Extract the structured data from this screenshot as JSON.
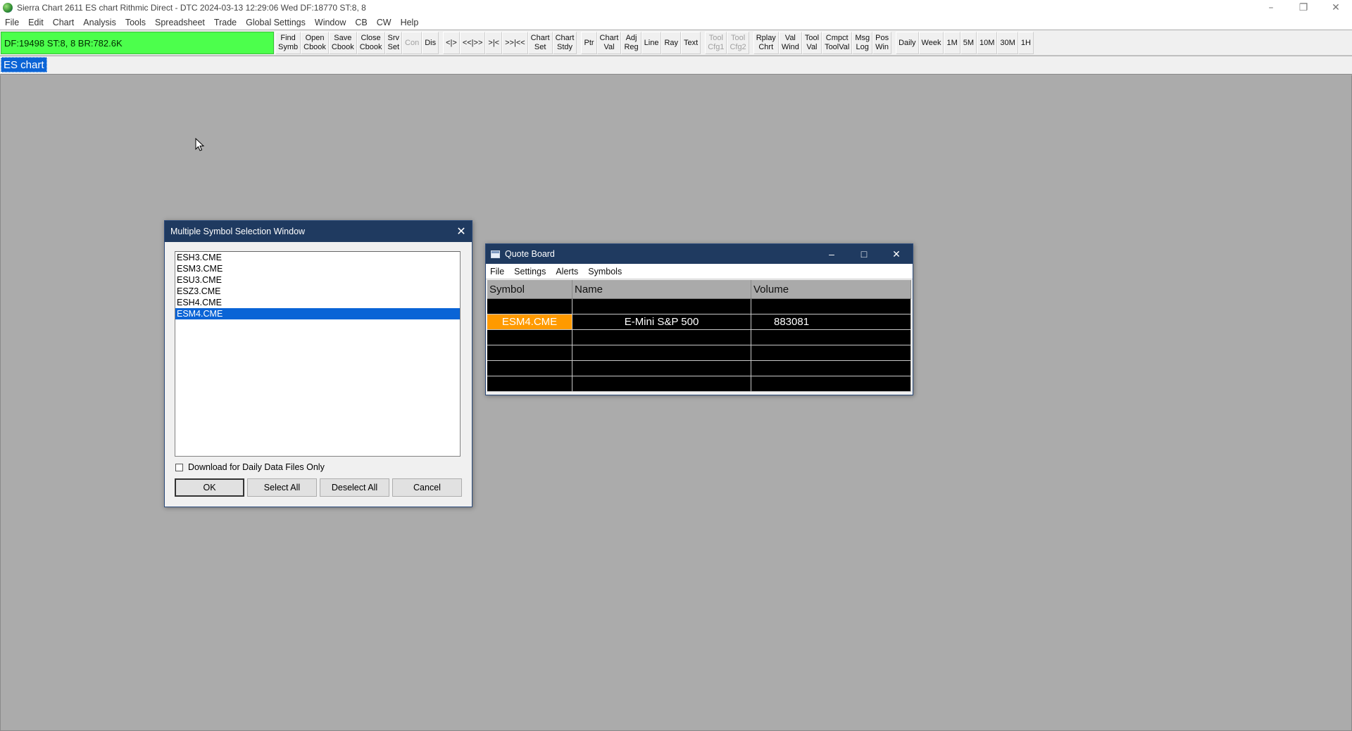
{
  "window": {
    "title": "Sierra Chart 2611 ES chart Rithmic Direct - DTC 2024-03-13  12:29:06 Wed DF:18770  ST:8, 8",
    "controls": [
      "minimize",
      "restore",
      "close"
    ]
  },
  "menu": [
    "File",
    "Edit",
    "Chart",
    "Analysis",
    "Tools",
    "Spreadsheet",
    "Trade",
    "Global Settings",
    "Window",
    "CB",
    "CW",
    "Help"
  ],
  "status": {
    "text": "DF:19498  ST:8, 8  BR:782.6K",
    "color": "#4cff4c"
  },
  "toolbar": {
    "buttons": [
      {
        "label": "Find\nSymb",
        "enabled": true
      },
      {
        "label": "Open\nCbook",
        "enabled": true
      },
      {
        "label": "Save\nCbook",
        "enabled": true
      },
      {
        "label": "Close\nCbook",
        "enabled": true
      },
      {
        "label": "Srv\nSet",
        "enabled": true
      },
      {
        "label": "Con",
        "enabled": false
      },
      {
        "label": "Dis",
        "enabled": true
      },
      {
        "label": "<|>",
        "enabled": true
      },
      {
        "label": "<<|>>",
        "enabled": true
      },
      {
        "label": ">|<",
        "enabled": true
      },
      {
        "label": ">>|<<",
        "enabled": true
      },
      {
        "label": "Chart\nSet",
        "enabled": true
      },
      {
        "label": "Chart\nStdy",
        "enabled": true
      },
      {
        "label": "Ptr",
        "enabled": true
      },
      {
        "label": "Chart\nVal",
        "enabled": true
      },
      {
        "label": "Adj\nReg",
        "enabled": true
      },
      {
        "label": "Line",
        "enabled": true
      },
      {
        "label": "Ray",
        "enabled": true
      },
      {
        "label": "Text",
        "enabled": true
      },
      {
        "label": "Tool\nCfg1",
        "enabled": false
      },
      {
        "label": "Tool\nCfg2",
        "enabled": false
      },
      {
        "label": "Rplay\nChrt",
        "enabled": true
      },
      {
        "label": "Val\nWind",
        "enabled": true
      },
      {
        "label": "Tool\nVal",
        "enabled": true
      },
      {
        "label": "Cmpct\nToolVal",
        "enabled": true
      },
      {
        "label": "Msg\nLog",
        "enabled": true
      },
      {
        "label": "Pos\nWin",
        "enabled": true
      },
      {
        "label": "Daily",
        "enabled": true
      },
      {
        "label": "Week",
        "enabled": true
      },
      {
        "label": "1M",
        "enabled": true
      },
      {
        "label": "5M",
        "enabled": true
      },
      {
        "label": "10M",
        "enabled": true
      },
      {
        "label": "30M",
        "enabled": true
      },
      {
        "label": "1H",
        "enabled": true
      }
    ]
  },
  "chart_tab": {
    "label": "ES chart"
  },
  "symbol_dialog": {
    "title": "Multiple Symbol Selection Window",
    "symbols": [
      {
        "name": "ESH3.CME",
        "selected": false
      },
      {
        "name": "ESM3.CME",
        "selected": false
      },
      {
        "name": "ESU3.CME",
        "selected": false
      },
      {
        "name": "ESZ3.CME",
        "selected": false
      },
      {
        "name": "ESH4.CME",
        "selected": false
      },
      {
        "name": "ESM4.CME",
        "selected": true
      }
    ],
    "checkbox_label": "Download for Daily Data Files Only",
    "checkbox_checked": false,
    "ok_label": "OK",
    "select_all_label": "Select All",
    "deselect_all_label": "Deselect All",
    "cancel_label": "Cancel"
  },
  "quote_board": {
    "title": "Quote Board",
    "menu": [
      "File",
      "Settings",
      "Alerts",
      "Symbols"
    ],
    "columns": [
      "Symbol",
      "Name",
      "Volume"
    ],
    "rows": [
      {
        "symbol": "",
        "name": "",
        "volume": ""
      },
      {
        "symbol": "ESM4.CME",
        "name": "E-Mini S&P 500",
        "volume": "883081",
        "highlight": "#ff9a00"
      },
      {
        "symbol": "",
        "name": "",
        "volume": ""
      },
      {
        "symbol": "",
        "name": "",
        "volume": ""
      },
      {
        "symbol": "",
        "name": "",
        "volume": ""
      },
      {
        "symbol": "",
        "name": "",
        "volume": ""
      }
    ]
  }
}
